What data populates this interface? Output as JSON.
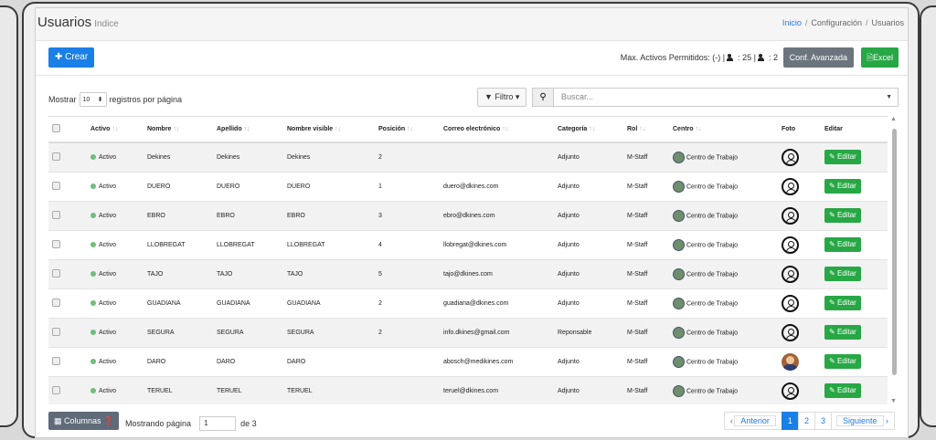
{
  "header": {
    "title": "Usuarios",
    "subtitle": "Indice",
    "breadcrumb": {
      "home": "Inicio",
      "config": "Configuración",
      "current": "Usuarios"
    }
  },
  "toolbar": {
    "create_label": "Crear",
    "limits_prefix": "Max. Activos Permitidos: (-) |",
    "limit_a": ": 25 |",
    "limit_b": ": 2",
    "config_label": "Conf. Avanzada",
    "excel_label": "Excel"
  },
  "controls": {
    "show_label": "Mostrar",
    "per_page": "10",
    "per_page_suffix": "registros por página",
    "filter_label": "Filtro",
    "search_placeholder": "Buscar..."
  },
  "table": {
    "headers": {
      "activo": "Activo",
      "nombre": "Nombre",
      "apellido": "Apellido",
      "visible": "Nombre visible",
      "posicion": "Posición",
      "correo": "Correo electrónico",
      "categoria": "Categoría",
      "rol": "Rol",
      "centro": "Centro",
      "foto": "Foto",
      "editar": "Editar"
    },
    "rows": [
      {
        "estado": "Activo",
        "nombre": "Dekines",
        "apellido": "Dekines",
        "visible": "Dekines",
        "posicion": "2",
        "correo": "",
        "categoria": "Adjunto",
        "rol": "M-Staff",
        "centro": "Centro de Trabajo",
        "foto": "icon",
        "editar": "Editar"
      },
      {
        "estado": "Activo",
        "nombre": "DUERO",
        "apellido": "DUERO",
        "visible": "DUERO",
        "posicion": "1",
        "correo": "duero@dkines.com",
        "categoria": "Adjunto",
        "rol": "M-Staff",
        "centro": "Centro de Trabajo",
        "foto": "icon",
        "editar": "Editar"
      },
      {
        "estado": "Activo",
        "nombre": "EBRO",
        "apellido": "EBRO",
        "visible": "EBRO",
        "posicion": "3",
        "correo": "ebro@dkines.com",
        "categoria": "Adjunto",
        "rol": "M-Staff",
        "centro": "Centro de Trabajo",
        "foto": "icon",
        "editar": "Editar"
      },
      {
        "estado": "Activo",
        "nombre": "LLOBREGAT",
        "apellido": "LLOBREGAT",
        "visible": "LLOBREGAT",
        "posicion": "4",
        "correo": "llobregat@dkines.com",
        "categoria": "Adjunto",
        "rol": "M-Staff",
        "centro": "Centro de Trabajo",
        "foto": "icon",
        "editar": "Editar"
      },
      {
        "estado": "Activo",
        "nombre": "TAJO",
        "apellido": "TAJO",
        "visible": "TAJO",
        "posicion": "5",
        "correo": "tajo@dkines.com",
        "categoria": "Adjunto",
        "rol": "M-Staff",
        "centro": "Centro de Trabajo",
        "foto": "icon",
        "editar": "Editar"
      },
      {
        "estado": "Activo",
        "nombre": "GUADIANA",
        "apellido": "GUADIANA",
        "visible": "GUADIANA",
        "posicion": "2",
        "correo": "guadiana@dkines.com",
        "categoria": "Adjunto",
        "rol": "M-Staff",
        "centro": "Centro de Trabajo",
        "foto": "icon",
        "editar": "Editar"
      },
      {
        "estado": "Activo",
        "nombre": "SEGURA",
        "apellido": "SEGURA",
        "visible": "SEGURA",
        "posicion": "2",
        "correo": "info.dkines@gmail.com",
        "categoria": "Reponsable",
        "rol": "M-Staff",
        "centro": "Centro de Trabajo",
        "foto": "icon",
        "editar": "Editar"
      },
      {
        "estado": "Activo",
        "nombre": "DARO",
        "apellido": "DARO",
        "visible": "DARO",
        "posicion": "",
        "correo": "abosch@medikines.com",
        "categoria": "Adjunto",
        "rol": "M-Staff",
        "centro": "Centro de Trabajo",
        "foto": "photo",
        "editar": "Editar"
      },
      {
        "estado": "Activo",
        "nombre": "TERUEL",
        "apellido": "TERUEL",
        "visible": "TERUEL",
        "posicion": "",
        "correo": "teruel@dkines.com",
        "categoria": "Adjunto",
        "rol": "M-Staff",
        "centro": "Centro de Trabajo",
        "foto": "icon",
        "editar": "Editar"
      }
    ]
  },
  "footer": {
    "columns_label": "Columnas",
    "showing_label": "Mostrando página",
    "page_value": "1",
    "of_label": "de 3",
    "prev_label": "Anterior",
    "pages": [
      "1",
      "2",
      "3"
    ],
    "next_label": "Siguiente"
  },
  "colors": {
    "primary": "#1a7fe6",
    "success": "#28a745",
    "secondary": "#6c757d"
  }
}
